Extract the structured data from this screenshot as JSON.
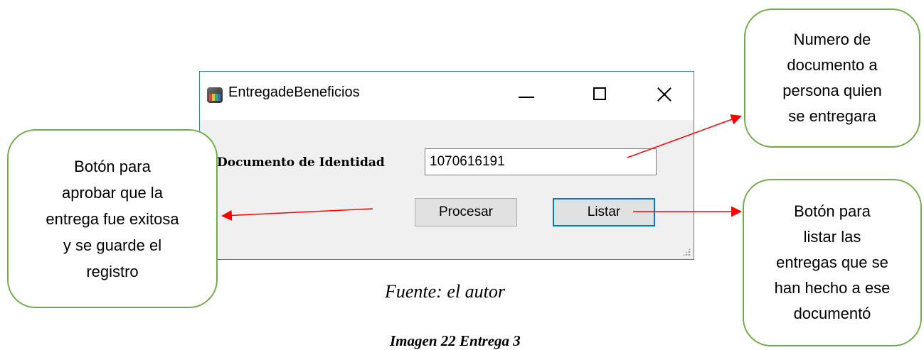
{
  "window": {
    "title": "EntregadeBeneficios",
    "icon": "app-icon",
    "controls": {
      "minimize": "minimize-icon",
      "maximize": "maximize-icon",
      "close": "close-icon"
    }
  },
  "form": {
    "document_label": "Documento de Identidad",
    "document_value": "1070616191",
    "process_button": "Procesar",
    "list_button": "Listar"
  },
  "callouts": {
    "left": "Botón para\naprobar que la\nentrega fue exitosa\ny se guarde el\nregistro",
    "top_right": "Numero de\ndocumento a\npersona quien\nse entregara",
    "bottom_right": "Botón para\nlistar las\nentregas que se\nhan hecho a ese\ndocumentó"
  },
  "caption": "Fuente: el autor",
  "figure_title": "Imagen 22 Entrega 3",
  "colors": {
    "callout_border": "#70ad47",
    "arrow": "#ff0000",
    "window_border": "#2f80d0",
    "focused_button_border": "#0078d7"
  }
}
